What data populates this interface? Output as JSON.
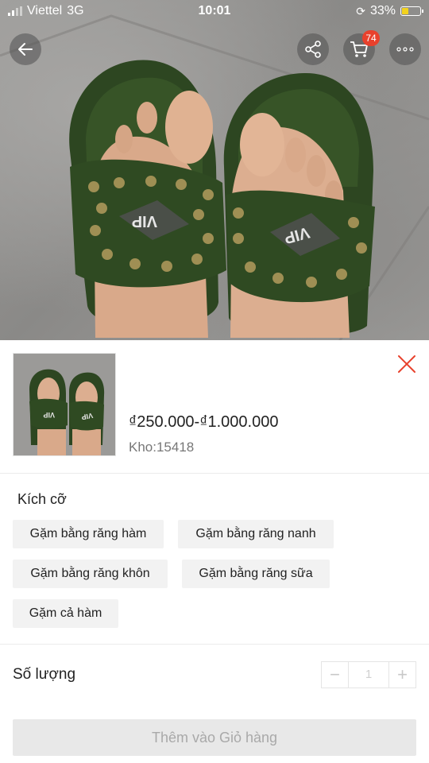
{
  "status_bar": {
    "carrier": "Viettel",
    "network": "3G",
    "time": "10:01",
    "battery": "33%",
    "battery_level": 0.33
  },
  "nav": {
    "back_icon": "arrow-left-icon",
    "share_icon": "share-icon",
    "cart_icon": "cart-icon",
    "cart_count": "74",
    "more_icon": "more-icon"
  },
  "product": {
    "price": "₫250.000-₫1.000.000",
    "stock": "Kho:15418"
  },
  "variants": {
    "title": "Kích cỡ",
    "options": [
      "Gặm bằng răng hàm",
      "Gặm bằng răng nanh",
      "Gặm bằng răng khôn",
      "Gặm bằng răng sữa",
      "Gặm cả hàm"
    ]
  },
  "quantity": {
    "title": "Số lượng",
    "minus": "−",
    "value": "1",
    "plus": "+"
  },
  "actions": {
    "add_to_cart": "Thêm vào Giỏ hàng"
  },
  "colors": {
    "accent": "#e8412c",
    "disabled_button": "#e8e8e8",
    "sandal_green": "#2f4a22"
  }
}
